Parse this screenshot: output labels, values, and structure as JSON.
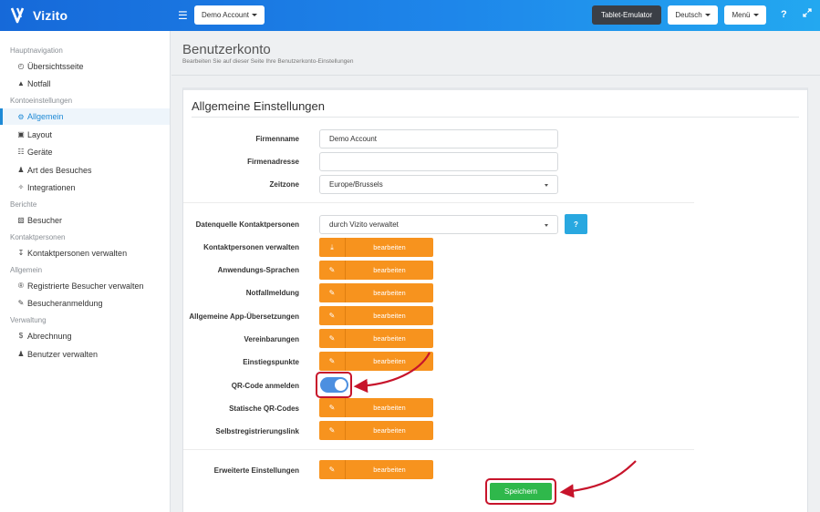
{
  "brand": {
    "name": "Vizito"
  },
  "topbar": {
    "account_dropdown": "Demo Account",
    "tablet_emulator": "Tablet-Emulator",
    "language_dropdown": "Deutsch",
    "menu_dropdown": "Menü",
    "help_icon": "?",
    "accent": "#1e86ea"
  },
  "sidebar": {
    "headings": [
      "Hauptnavigation",
      "Kontoeinstellungen",
      "Berichte",
      "Kontaktpersonen",
      "Allgemein",
      "Verwaltung"
    ],
    "items": [
      {
        "label": "Übersichtsseite",
        "icon": "gauge-icon"
      },
      {
        "label": "Notfall",
        "icon": "warning-icon"
      },
      {
        "label": "Allgemein",
        "icon": "gear-icon",
        "active": true
      },
      {
        "label": "Layout",
        "icon": "image-icon"
      },
      {
        "label": "Geräte",
        "icon": "sitemap-icon"
      },
      {
        "label": "Art des Besuches",
        "icon": "users-icon"
      },
      {
        "label": "Integrationen",
        "icon": "plug-icon"
      },
      {
        "label": "Besucher",
        "icon": "book-icon"
      },
      {
        "label": "Kontaktpersonen verwalten",
        "icon": "download-icon"
      },
      {
        "label": "Registrierte Besucher verwalten",
        "icon": "registered-icon"
      },
      {
        "label": "Besucheranmeldung",
        "icon": "edit-icon"
      },
      {
        "label": "Abrechnung",
        "icon": "dollar-icon"
      },
      {
        "label": "Benutzer verwalten",
        "icon": "user-plus-icon"
      }
    ]
  },
  "page": {
    "title": "Benutzerkonto",
    "subtitle": "Bearbeiten Sie auf dieser Seite Ihre Benutzerkonto-Einstellungen"
  },
  "panel": {
    "title": "Allgemeine Einstellungen",
    "fields": {
      "firmenname_label": "Firmenname",
      "firmenname_value": "Demo Account",
      "firmenadresse_label": "Firmenadresse",
      "firmenadresse_value": "",
      "zeitzone_label": "Zeitzone",
      "zeitzone_value": "Europe/Brussels",
      "datenquelle_label": "Datenquelle Kontaktpersonen",
      "datenquelle_value": "durch Vizito verwaltet",
      "help_label": "?"
    },
    "edit_label": "bearbeiten",
    "edit_rows": [
      {
        "label": "Kontaktpersonen verwalten",
        "icon": "download-icon"
      },
      {
        "label": "Anwendungs-Sprachen",
        "icon": "edit-icon"
      },
      {
        "label": "Notfallmeldung",
        "icon": "edit-icon"
      },
      {
        "label": "Allgemeine App-Übersetzungen",
        "icon": "edit-icon"
      },
      {
        "label": "Vereinbarungen",
        "icon": "edit-icon"
      },
      {
        "label": "Einstiegspunkte",
        "icon": "edit-icon"
      },
      {
        "label": "Statische QR-Codes",
        "icon": "edit-icon"
      },
      {
        "label": "Selbstregistrierungslink",
        "icon": "edit-icon"
      },
      {
        "label": "Erweiterte Einstellungen",
        "icon": "edit-icon"
      }
    ],
    "qr_toggle": {
      "label": "QR-Code anmelden",
      "on": true
    },
    "save_label": "Speichern",
    "colors": {
      "edit": "#f7931e",
      "save": "#2fb84b",
      "highlight": "#c7142b"
    }
  }
}
